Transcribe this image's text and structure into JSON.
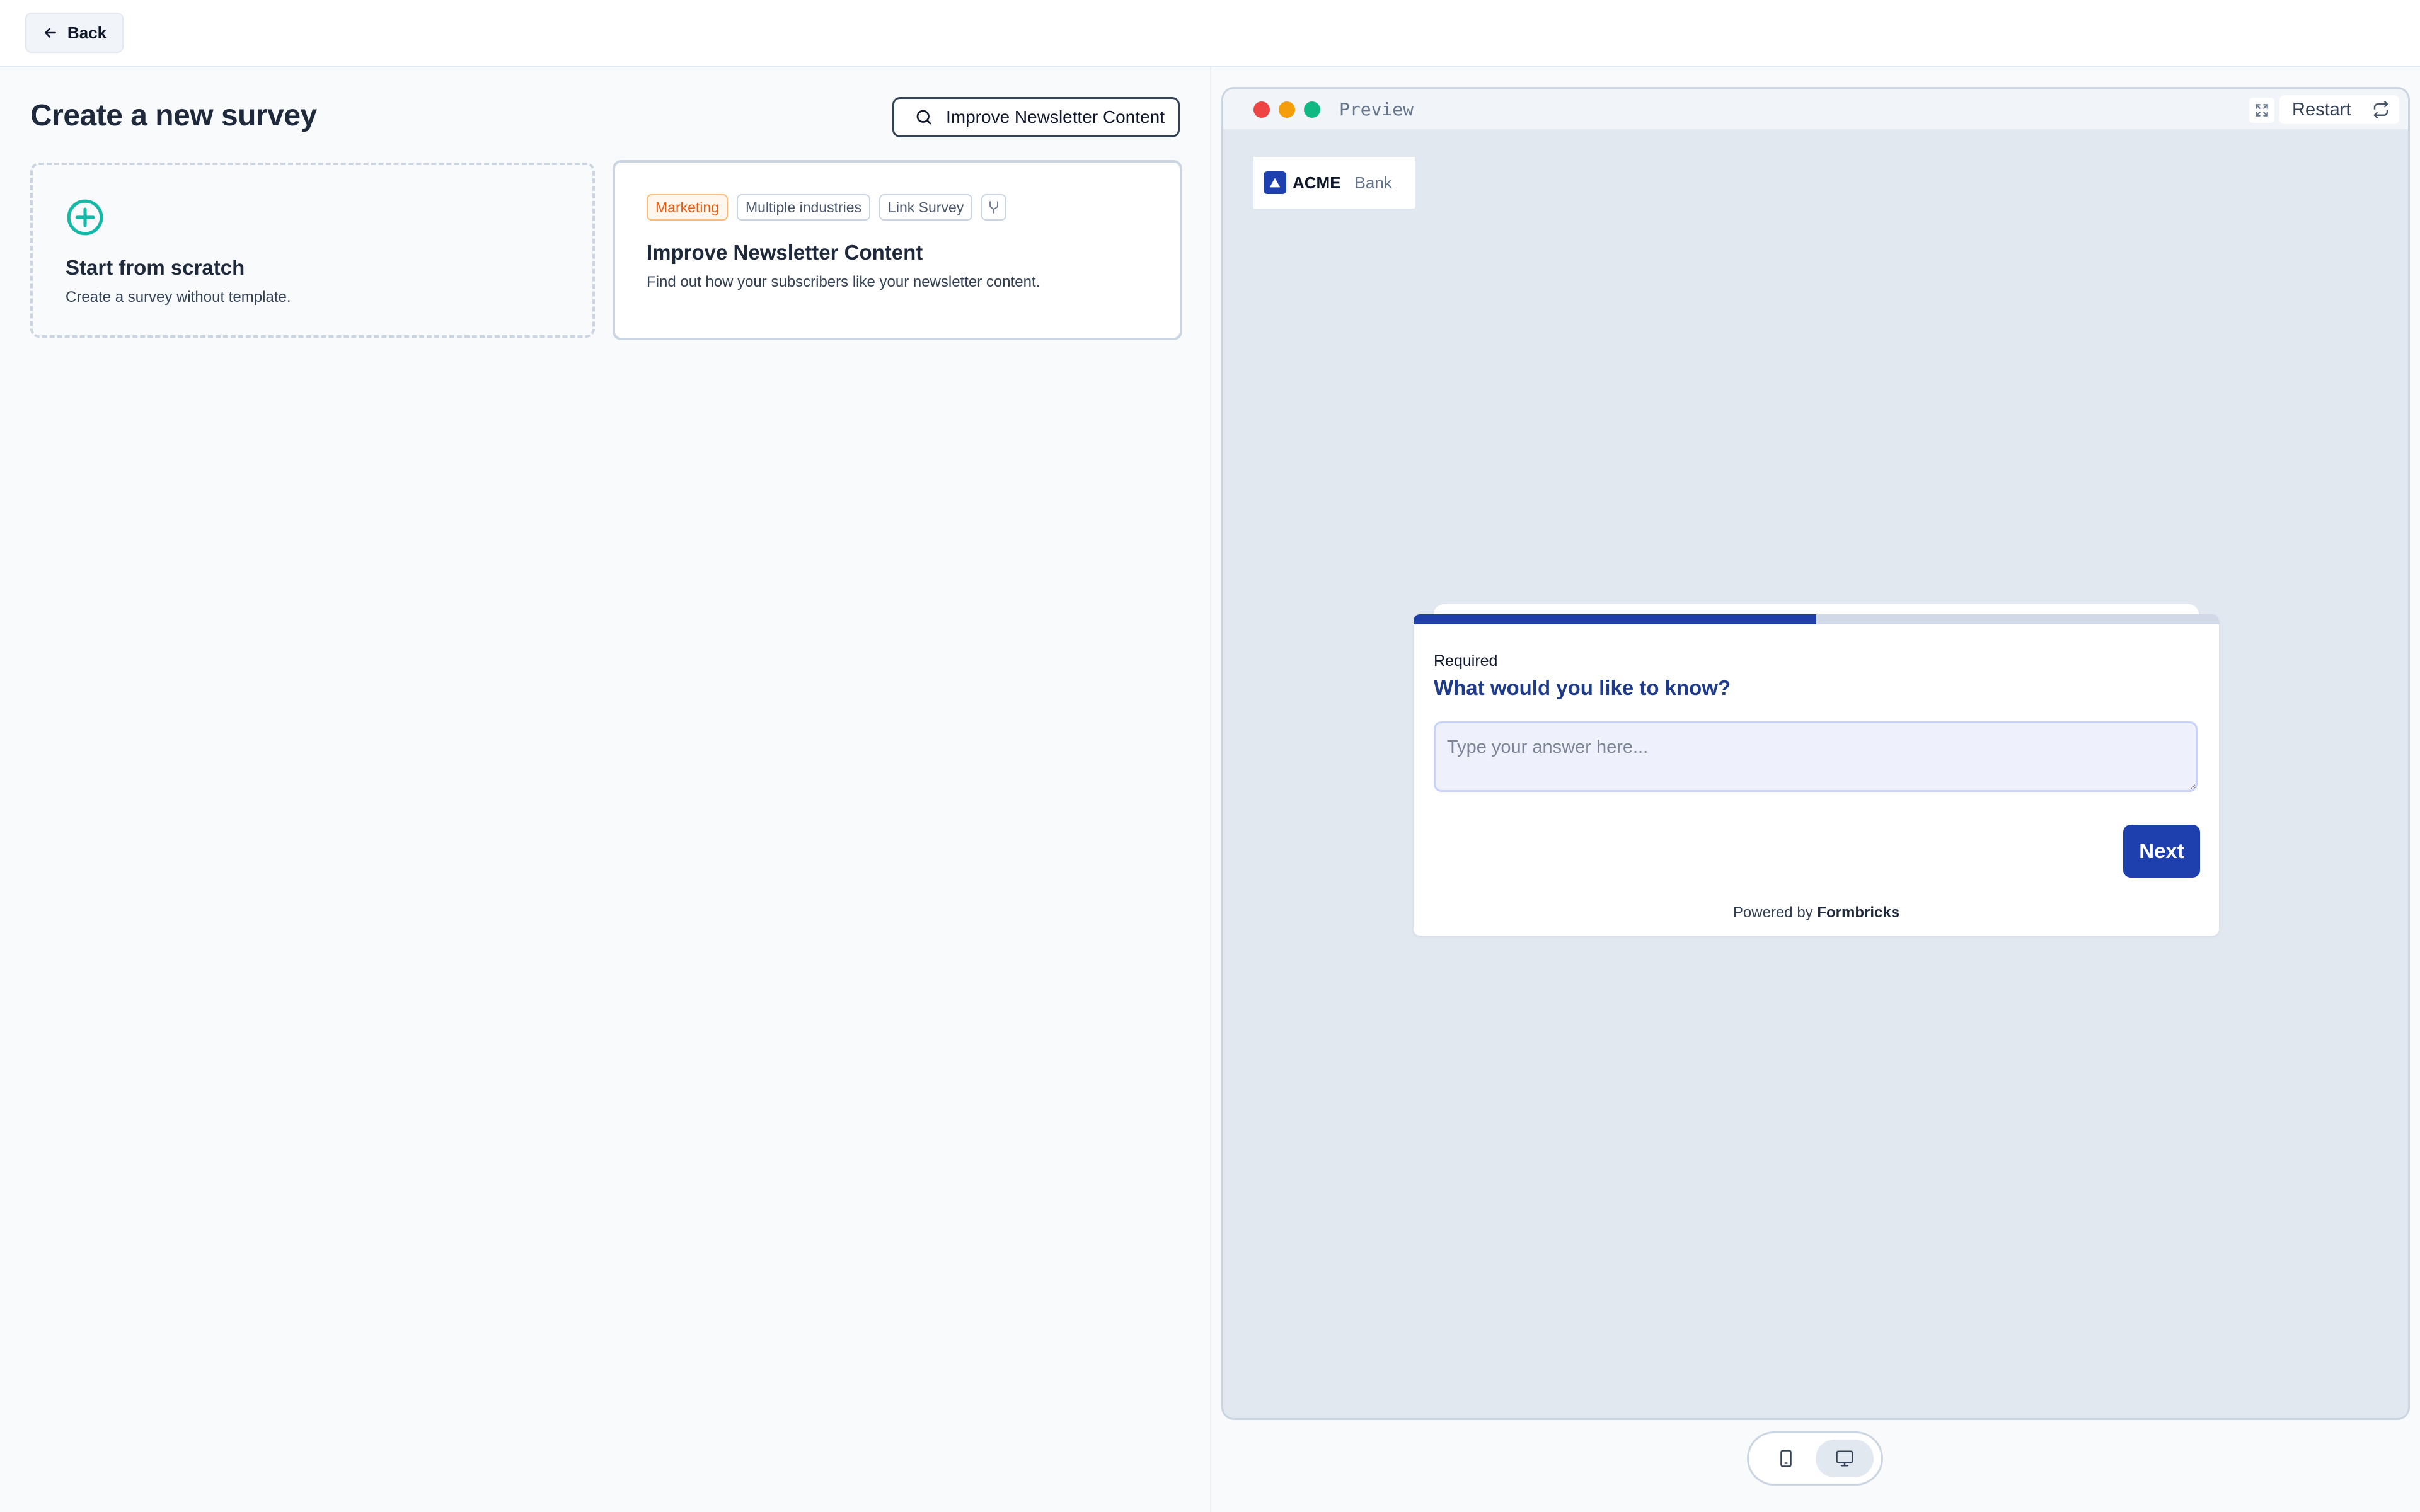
{
  "topbar": {
    "back_label": "Back"
  },
  "page": {
    "title": "Create a new survey"
  },
  "search": {
    "value": "Improve Newsletter Content",
    "icon": "search-icon"
  },
  "scratch_card": {
    "title": "Start from scratch",
    "description": "Create a survey without template.",
    "icon": "plus-circle-icon",
    "accent_color": "#14b8a6"
  },
  "template_card": {
    "tags": [
      "Marketing",
      "Multiple industries",
      "Link Survey"
    ],
    "branch_icon": "branch-icon",
    "title": "Improve Newsletter Content",
    "description": "Find out how your subscribers like your newsletter content."
  },
  "preview": {
    "label": "Preview",
    "restart_label": "Restart",
    "brand": {
      "name": "ACME",
      "sub": "Bank"
    },
    "survey": {
      "progress": 0.5,
      "required_label": "Required",
      "question": "What would you like to know?",
      "answer_placeholder": "Type your answer here...",
      "next_label": "Next",
      "powered_prefix": "Powered by",
      "powered_brand": "Formbricks"
    }
  },
  "device_toggle": {
    "options": [
      "mobile",
      "desktop"
    ],
    "selected": "desktop"
  },
  "colors": {
    "brand": "#1e40af",
    "accent": "#14b8a6",
    "marketing_tag": "#ea580c"
  }
}
